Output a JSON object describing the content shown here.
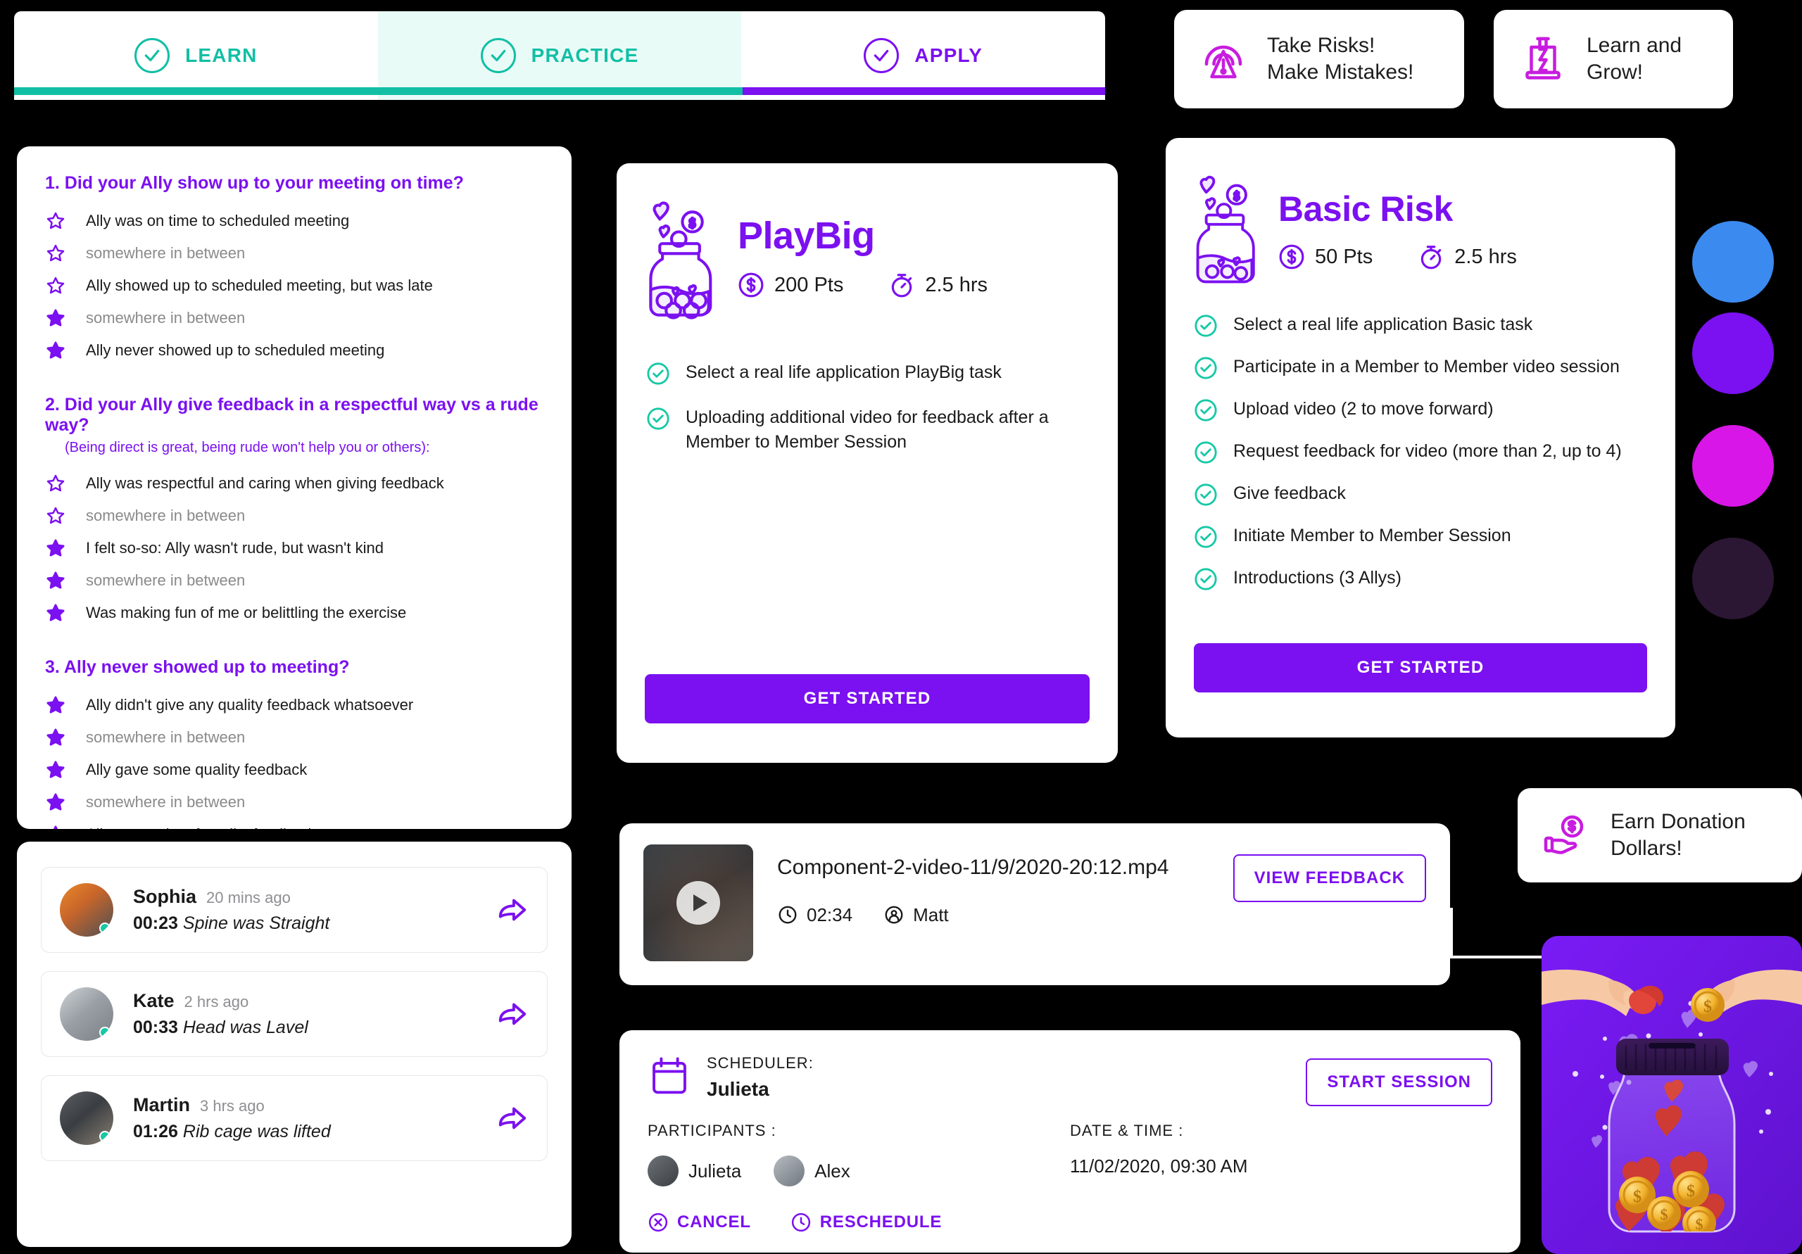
{
  "tabs": [
    {
      "label": "LEARN",
      "icon": "check-circle-icon",
      "active": false,
      "color": "#12BFA5"
    },
    {
      "label": "PRACTICE",
      "icon": "check-circle-icon",
      "active": true,
      "color": "#12BFA5"
    },
    {
      "label": "APPLY",
      "icon": "check-circle-icon",
      "active": false,
      "color": "#7B10F0"
    }
  ],
  "badges": {
    "take_risks": {
      "line1": "Take Risks!",
      "line2": "Make Mistakes!",
      "icon": "risk-warning-icon"
    },
    "learn_grow": {
      "line1": "Learn and",
      "line2": "Grow!",
      "icon": "growth-hourglass-icon"
    },
    "earn_donation": {
      "line1": "Earn Donation",
      "line2": "Dollars!",
      "icon": "hand-coin-icon"
    }
  },
  "questions": [
    {
      "number": "1.",
      "title": "Did your Ally show up to your meeting on time?",
      "subtitle": "",
      "options": [
        {
          "label": "Ally was on time to scheduled meeting",
          "filled": false,
          "muted": false
        },
        {
          "label": "somewhere in between",
          "filled": false,
          "muted": true
        },
        {
          "label": "Ally showed up to scheduled meeting, but was late",
          "filled": false,
          "muted": false
        },
        {
          "label": "somewhere in between",
          "filled": true,
          "muted": true
        },
        {
          "label": "Ally never showed up to scheduled meeting",
          "filled": true,
          "muted": false
        }
      ]
    },
    {
      "number": "2.",
      "title": "Did your Ally give feedback in a respectful way vs a rude way?",
      "subtitle": "(Being direct is great, being rude won't help you or others):",
      "options": [
        {
          "label": "Ally was respectful and caring when giving feedback",
          "filled": false,
          "muted": false
        },
        {
          "label": "somewhere in between",
          "filled": false,
          "muted": true
        },
        {
          "label": "I felt so-so: Ally wasn't rude, but wasn't kind",
          "filled": true,
          "muted": false
        },
        {
          "label": "somewhere in between",
          "filled": true,
          "muted": true
        },
        {
          "label": "Was making fun of me or belittling the exercise",
          "filled": true,
          "muted": false
        }
      ]
    },
    {
      "number": "3.",
      "title": "Ally never showed up to meeting?",
      "subtitle": "",
      "options": [
        {
          "label": "Ally didn't give any quality feedback whatsoever",
          "filled": true,
          "muted": false
        },
        {
          "label": "somewhere in between",
          "filled": true,
          "muted": true
        },
        {
          "label": "Ally gave some quality feedback",
          "filled": true,
          "muted": false
        },
        {
          "label": "somewhere in between",
          "filled": true,
          "muted": true
        },
        {
          "label": "Ally gave a lot of quality feedback",
          "filled": true,
          "muted": false
        }
      ]
    }
  ],
  "task_cards": [
    {
      "name": "PlayBig",
      "points": "200 Pts",
      "duration": "2.5 hrs",
      "points_icon": "dollar-circle-icon",
      "duration_icon": "stopwatch-icon",
      "jar_icon": "donation-jar-icon",
      "items": [
        "Select a real life application PlayBig task",
        "Uploading additional video for feedback after a Member to Member Session"
      ],
      "cta": "GET STARTED"
    },
    {
      "name": "Basic Risk",
      "points": "50 Pts",
      "duration": "2.5 hrs",
      "points_icon": "dollar-circle-icon",
      "duration_icon": "stopwatch-icon",
      "jar_icon": "donation-jar-icon",
      "items": [
        "Select a real life application Basic task",
        "Participate in a Member to Member video session",
        "Upload video (2 to move forward)",
        "Request feedback for video (more than 2, up to 4)",
        "Give feedback",
        "Initiate Member to Member Session",
        "Introductions (3 Allys)"
      ],
      "cta": "GET STARTED"
    }
  ],
  "swatches": [
    {
      "name": "blue",
      "hex": "#3B8AF0"
    },
    {
      "name": "purple",
      "hex": "#7B10F0"
    },
    {
      "name": "magenta",
      "hex": "#D916E8"
    },
    {
      "name": "dark-plum",
      "hex": "#2B1633"
    }
  ],
  "comments": [
    {
      "name": "Sophia",
      "ago": "20 mins ago",
      "time": "00:23",
      "text": "Spine was Straight",
      "share_icon": "share-arrow-icon",
      "avatar": "avatar-sophia"
    },
    {
      "name": "Kate",
      "ago": "2 hrs ago",
      "time": "00:33",
      "text": "Head was Lavel",
      "share_icon": "share-arrow-icon",
      "avatar": "avatar-kate"
    },
    {
      "name": "Martin",
      "ago": "3 hrs ago",
      "time": "01:26",
      "text": "Rib cage was lifted",
      "share_icon": "share-arrow-icon",
      "avatar": "avatar-martin"
    }
  ],
  "video": {
    "title": "Component-2-video-11/9/2020-20:12.mp4",
    "duration": "02:34",
    "author": "Matt",
    "duration_icon": "clock-icon",
    "author_icon": "person-circle-icon",
    "play_icon": "play-icon",
    "view_feedback": "VIEW FEEDBACK"
  },
  "scheduler": {
    "label": "SCHEDULER:",
    "name": "Julieta",
    "calendar_icon": "calendar-icon",
    "participants_label": "PARTICIPANTS :",
    "participants": [
      "Julieta",
      "Alex"
    ],
    "datetime_label": "DATE & TIME :",
    "datetime": "11/02/2020, 09:30 AM",
    "start_session": "START SESSION",
    "cancel": "CANCEL",
    "reschedule": "RESCHEDULE",
    "cancel_icon": "cancel-circle-icon",
    "reschedule_icon": "clock-circle-icon"
  },
  "illustration": {
    "name": "donation-jar-illustration"
  }
}
